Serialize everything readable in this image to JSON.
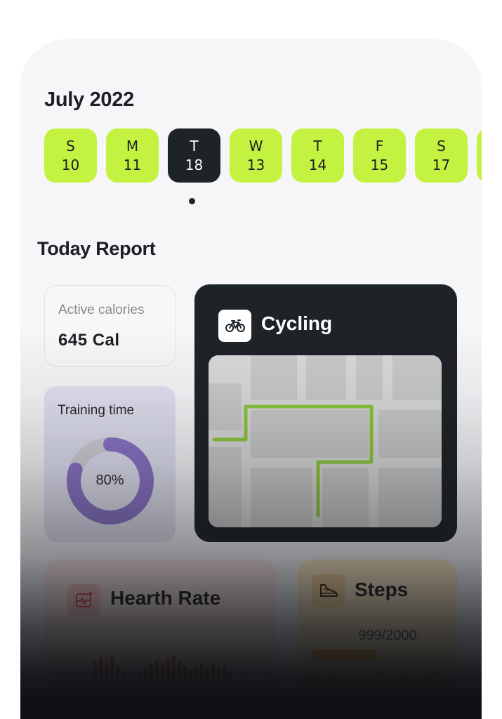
{
  "calendar": {
    "month_label": "July 2022",
    "days": [
      {
        "letter": "S",
        "date": "10",
        "active": false
      },
      {
        "letter": "M",
        "date": "11",
        "active": false
      },
      {
        "letter": "T",
        "date": "18",
        "active": true
      },
      {
        "letter": "W",
        "date": "13",
        "active": false
      },
      {
        "letter": "T",
        "date": "14",
        "active": false
      },
      {
        "letter": "F",
        "date": "15",
        "active": false
      },
      {
        "letter": "S",
        "date": "17",
        "active": false
      }
    ]
  },
  "report": {
    "title": "Today Report",
    "active_calories": {
      "label": "Active calories",
      "value": "645 Cal"
    },
    "training_time": {
      "label": "Training time",
      "value_text": "80%",
      "progress": 0.8,
      "color": "#8a74c8"
    },
    "cycling": {
      "title": "Cycling",
      "icon": "bicycle-icon",
      "route_color": "#8dc63f"
    },
    "heart_rate": {
      "title": "Hearth Rate",
      "icon": "heart-monitor-icon",
      "accent": "#e14b4b"
    },
    "steps": {
      "title": "Steps",
      "icon": "sneaker-icon",
      "count_text": "999/2000",
      "progress": 0.4995,
      "accent": "#f0a424"
    }
  },
  "colors": {
    "accent_green": "#c3f240",
    "dark": "#1e2328"
  }
}
